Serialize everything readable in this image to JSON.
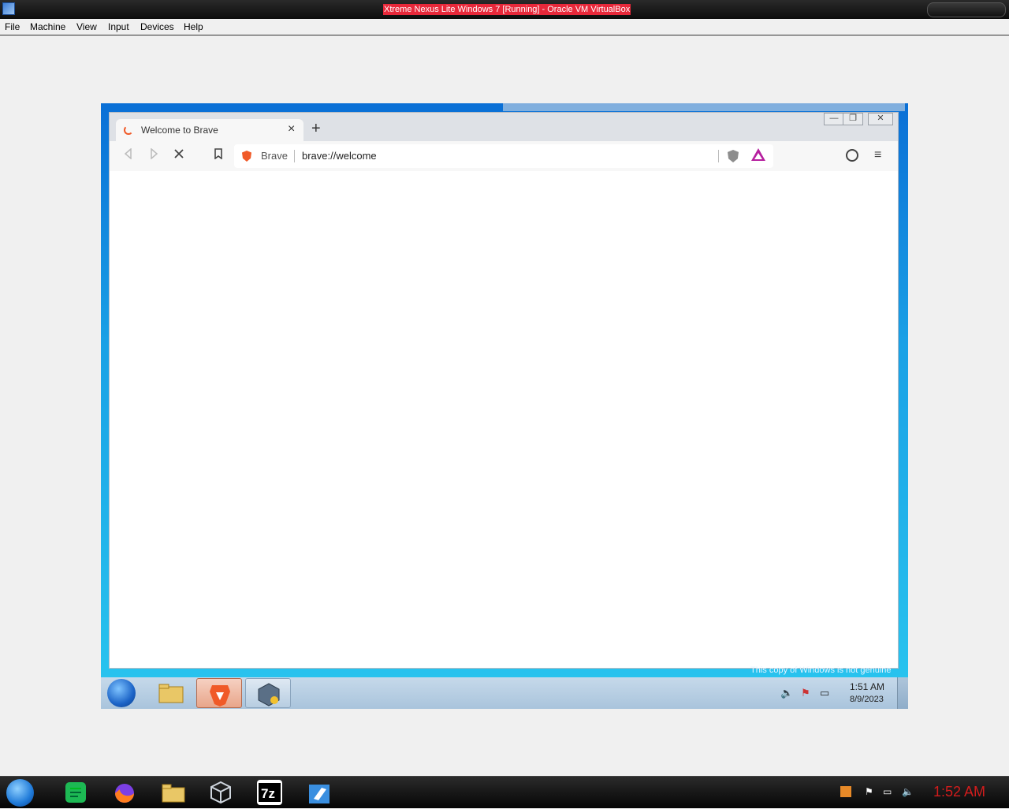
{
  "host": {
    "title": "Xtreme Nexus Lite Windows 7 [Running] - Oracle VM VirtualBox",
    "menu": [
      "File",
      "Machine",
      "View",
      "Input",
      "Devices",
      "Help"
    ],
    "taskbar": {
      "clock": "1:52 AM",
      "icons": [
        "start-orb-icon",
        "sticky-notes-icon",
        "firefox-icon",
        "file-explorer-icon",
        "virtualbox-icon",
        "7zip-icon",
        "windows7-usb-tool-icon"
      ]
    }
  },
  "browser": {
    "tab_title": "Welcome to Brave",
    "tab_close": "×",
    "new_tab": "+",
    "site_label": "Brave",
    "url": "brave://welcome",
    "window_buttons": [
      "—",
      "❐",
      "✕"
    ],
    "nav_icons": [
      "back-arrow-icon",
      "forward-arrow-icon",
      "stop-icon",
      "bookmark-icon"
    ]
  },
  "vm": {
    "watermark": "This copy of Windows is not genuine",
    "clock_time": "1:51 AM",
    "clock_date": "8/9/2023",
    "taskbar_apps": [
      "windows-explorer-icon",
      "brave-icon",
      "virtualbox-extension-icon"
    ],
    "tray_icons": [
      "volume-icon",
      "action-center-flag-icon",
      "network-icon"
    ]
  },
  "colors": {
    "host_title_bg": "#e8283a",
    "brave_orange": "#f05a28",
    "rewards_purple": "#b6209f",
    "host_clock": "#d21c1c"
  }
}
